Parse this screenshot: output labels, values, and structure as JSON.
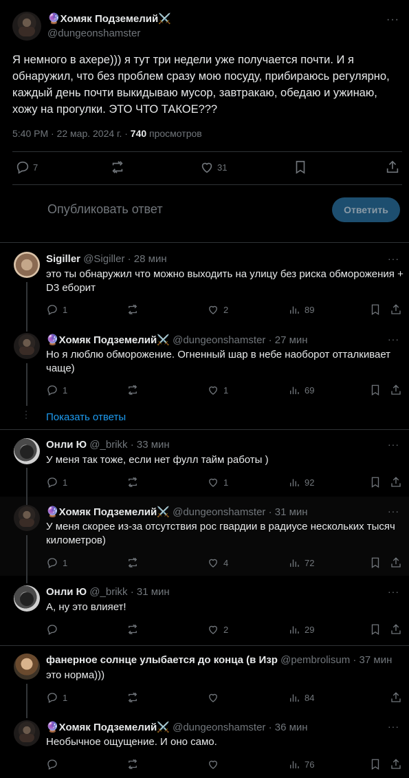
{
  "main_tweet": {
    "author_name": "🔮Хомяк Подземелий⚔️",
    "author_handle": "@dungeonshamster",
    "text": "Я немного в ахере))) я тут три недели уже получается почти. И я обнаружил, что без проблем сразу мою посуду, прибираюсь регулярно, каждый день почти выкидываю мусор, завтракаю, обедаю и ужинаю, хожу на прогулки. ЭТО ЧТО ТАКОЕ???",
    "time": "5:40 PM · 22 мар. 2024 г. · ",
    "views": "740",
    "views_label": "просмотров",
    "replies": "7",
    "likes": "31"
  },
  "reply_box": {
    "placeholder": "Опубликовать ответ",
    "button": "Ответить"
  },
  "show_replies": "Показать ответы",
  "replies": [
    {
      "name": "Sigiller",
      "handle": "@Sigiller",
      "time": "· 28 мин",
      "text": "это ты обнаружил что можно выходить на улицу без риска обморожения + D3 еборит",
      "replies": "1",
      "likes": "2",
      "views": "89"
    },
    {
      "name": "🔮Хомяк Подземелий⚔️",
      "handle": "@dungeonshamster",
      "time": "· 27 мин",
      "text": "Но я люблю обморожение. Огненный шар в небе наоборот отталкивает чаще)",
      "replies": "1",
      "likes": "1",
      "views": "69"
    },
    {
      "name": "Онли Ю",
      "handle": "@_brikk",
      "time": "· 33 мин",
      "text": "У меня так тоже, если нет фулл тайм работы )",
      "replies": "1",
      "likes": "1",
      "views": "92"
    },
    {
      "name": "🔮Хомяк Подземелий⚔️",
      "handle": "@dungeonshamster",
      "time": "· 31 мин",
      "text": "У меня скорее из-за отсутствия рос гвардии в радиусе нескольких тысяч километров)",
      "replies": "1",
      "likes": "4",
      "views": "72"
    },
    {
      "name": "Онли Ю",
      "handle": "@_brikk",
      "time": "· 31 мин",
      "text": "А, ну это влияет!",
      "replies": "",
      "likes": "2",
      "views": "29"
    },
    {
      "name": "фанерное солнце улыбается до конца (в Изр",
      "handle": "@pembrolisum",
      "time": "· 37 мин",
      "text": "это норма)))",
      "replies": "1",
      "likes": "",
      "views": "84"
    },
    {
      "name": "🔮Хомяк Подземелий⚔️",
      "handle": "@dungeonshamster",
      "time": "· 36 мин",
      "text": "Необычное ощущение. И оно само.",
      "replies": "",
      "likes": "",
      "views": "76"
    }
  ]
}
